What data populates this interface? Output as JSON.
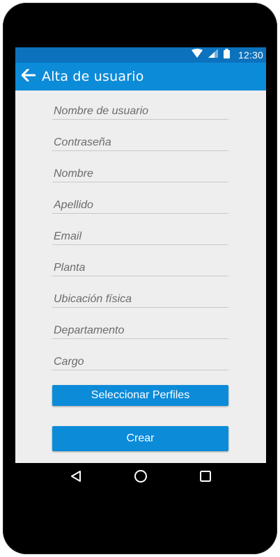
{
  "statusbar": {
    "time": "12:30",
    "icons": [
      "wifi-icon",
      "signal-icon",
      "battery-icon"
    ]
  },
  "appbar": {
    "title": "Alta de usuario",
    "back_icon": "arrow-left-icon"
  },
  "form": {
    "fields": [
      {
        "name": "username",
        "placeholder": "Nombre de usuario",
        "value": ""
      },
      {
        "name": "password",
        "placeholder": "Contraseña",
        "value": ""
      },
      {
        "name": "first-name",
        "placeholder": "Nombre",
        "value": ""
      },
      {
        "name": "last-name",
        "placeholder": "Apellido",
        "value": ""
      },
      {
        "name": "email",
        "placeholder": "Email",
        "value": ""
      },
      {
        "name": "plant",
        "placeholder": "Planta",
        "value": ""
      },
      {
        "name": "location",
        "placeholder": "Ubicación física",
        "value": ""
      },
      {
        "name": "department",
        "placeholder": "Departamento",
        "value": ""
      },
      {
        "name": "position",
        "placeholder": "Cargo",
        "value": ""
      }
    ],
    "select_profiles_label": "Seleccionar Perfiles",
    "create_label": "Crear"
  },
  "navbar": {
    "icons": [
      "back-triangle-icon",
      "home-circle-icon",
      "recents-square-icon"
    ]
  },
  "colors": {
    "status_bar": "#0c72bd",
    "app_bar": "#0c8bd9",
    "primary_button": "#0c8bd9",
    "screen_background": "#eeeeee",
    "device_frame": "#000000"
  }
}
